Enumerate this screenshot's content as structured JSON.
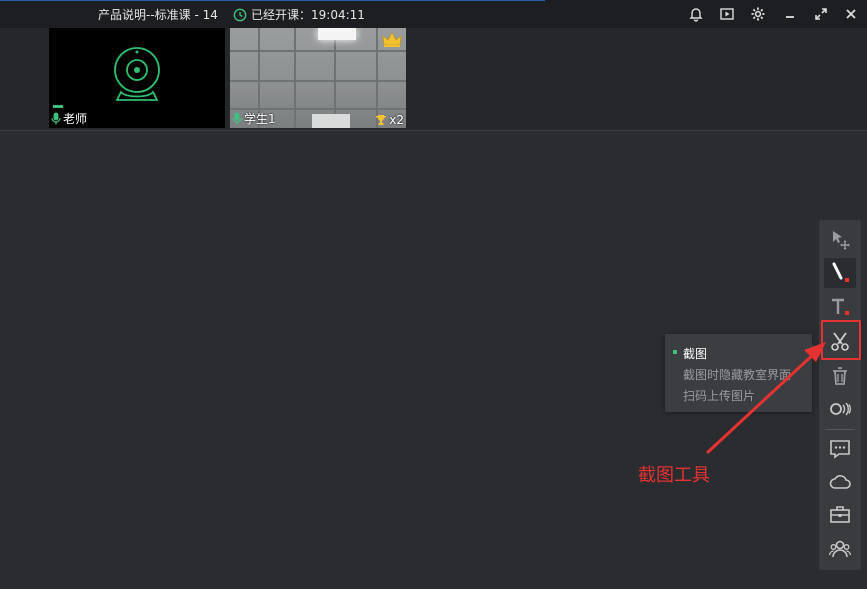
{
  "titlebar": {
    "course_title": "产品说明--标准课 - 14",
    "elapsed_label": "已经开课：19:04:11",
    "controls": [
      "bell-icon",
      "record-icon",
      "gear-icon",
      "minimize-icon",
      "fullscreen-icon",
      "close-icon"
    ]
  },
  "videos": [
    {
      "name": "老师",
      "icon": "webcam-placeholder-icon"
    },
    {
      "name": "学生1",
      "trophy_count": "x2",
      "icon": "crown-icon"
    }
  ],
  "toolbar": {
    "tools": [
      "select-move-icon",
      "pen-icon",
      "text-icon",
      "scissors-icon",
      "trash-icon",
      "laser-pointer-icon",
      "chat-icon",
      "cloud-icon",
      "toolbox-icon",
      "users-icon"
    ],
    "accent_color": "#e53232"
  },
  "screenshot_menu": {
    "items": [
      "截图",
      "截图时隐藏教室界面",
      "扫码上传图片"
    ]
  },
  "annotation": {
    "label": "截图工具",
    "color": "#e53232"
  }
}
